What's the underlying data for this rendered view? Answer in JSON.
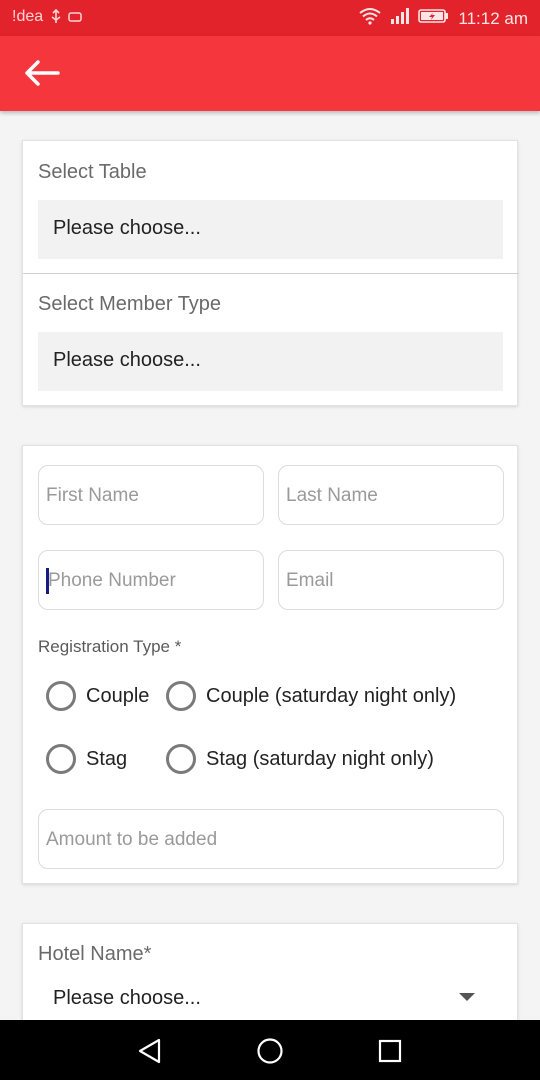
{
  "status_bar": {
    "carrier": "!dea",
    "time": "11:12 am"
  },
  "form": {
    "select_table": {
      "label": "Select Table",
      "value": "Please choose..."
    },
    "select_member_type": {
      "label": "Select Member Type",
      "value": "Please choose..."
    },
    "first_name": {
      "placeholder": "First Name",
      "value": ""
    },
    "last_name": {
      "placeholder": "Last Name",
      "value": ""
    },
    "phone": {
      "placeholder": "Phone Number",
      "value": ""
    },
    "email": {
      "placeholder": "Email",
      "value": ""
    },
    "registration_type": {
      "label": "Registration Type *",
      "options": [
        "Couple",
        "Couple (saturday night only)",
        "Stag",
        "Stag (saturday night only)"
      ]
    },
    "amount": {
      "placeholder": "Amount to be added",
      "value": ""
    },
    "hotel_name": {
      "label": "Hotel Name*",
      "value": "Please choose..."
    }
  },
  "icons": {
    "back": "arrow-back-icon",
    "wifi": "wifi-icon",
    "signal": "signal-icon",
    "battery": "battery-icon",
    "usb": "usb-icon",
    "nav_back": "triangle-back-icon",
    "nav_home": "circle-home-icon",
    "nav_recent": "square-recent-icon"
  },
  "colors": {
    "status_bar": "#e3232b",
    "app_bar": "#f6363d",
    "background": "#f4f4f4"
  }
}
